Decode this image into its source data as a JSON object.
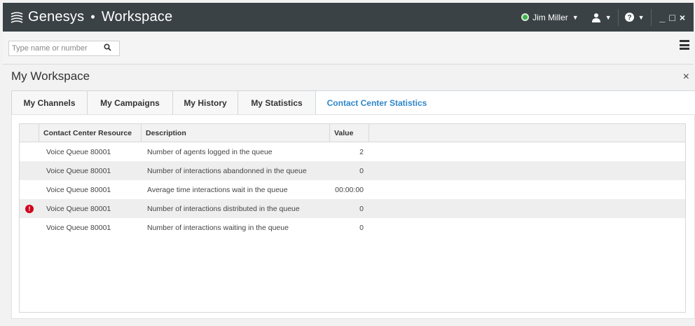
{
  "app": {
    "brand": "Genesys",
    "separator": "•",
    "product": "Workspace",
    "user_name": "Jim Miller",
    "user_status_color": "#3cb44b",
    "controls": {
      "minimize": "_",
      "maximize": "□",
      "close": "×"
    }
  },
  "search": {
    "placeholder": "Type name or number"
  },
  "workspace": {
    "title": "My Workspace",
    "close": "×",
    "tabs": [
      {
        "label": "My Channels"
      },
      {
        "label": "My Campaigns"
      },
      {
        "label": "My History"
      },
      {
        "label": "My Statistics"
      },
      {
        "label": "Contact Center Statistics",
        "active": true
      }
    ]
  },
  "table": {
    "columns": [
      "Contact Center Resource",
      "Description",
      "Value"
    ],
    "rows": [
      {
        "resource": "Voice Queue 80001",
        "description": "Number of agents logged in the queue",
        "value": "2",
        "alert": false
      },
      {
        "resource": "Voice Queue 80001",
        "description": "Number of interactions abandonned in the queue",
        "value": "0",
        "alert": false
      },
      {
        "resource": "Voice Queue 80001",
        "description": "Average time interactions wait in the queue",
        "value": "00:00:00",
        "alert": false
      },
      {
        "resource": "Voice Queue 80001",
        "description": "Number of interactions distributed in the queue",
        "value": "0",
        "alert": true,
        "alert_symbol": "!"
      },
      {
        "resource": "Voice Queue 80001",
        "description": "Number of interactions waiting in the queue",
        "value": "0",
        "alert": false
      }
    ]
  },
  "colors": {
    "titlebar": "#3b4246",
    "active_tab": "#2e86c9",
    "alert": "#d0021b"
  }
}
